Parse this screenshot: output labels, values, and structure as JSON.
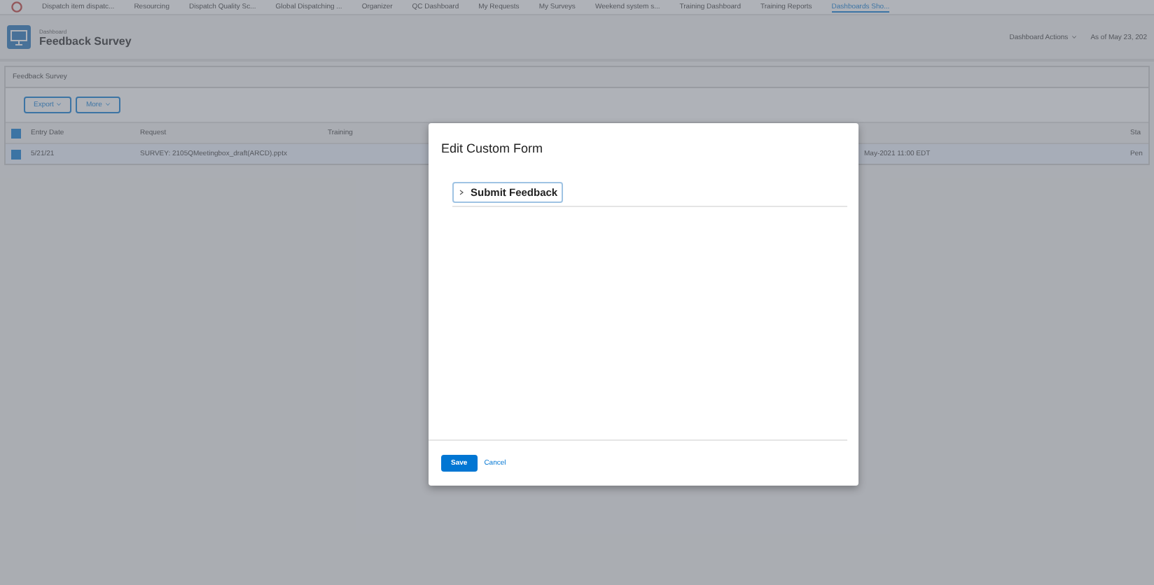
{
  "nav_tabs": [
    {
      "label": "Dispatch item dispatc...",
      "selected": false
    },
    {
      "label": "Resourcing",
      "selected": false
    },
    {
      "label": "Dispatch Quality Sc...",
      "selected": false
    },
    {
      "label": "Global Dispatching ...",
      "selected": false
    },
    {
      "label": "Organizer",
      "selected": false
    },
    {
      "label": "QC Dashboard",
      "selected": false
    },
    {
      "label": "My Requests",
      "selected": false
    },
    {
      "label": "My Surveys",
      "selected": false
    },
    {
      "label": "Weekend system s...",
      "selected": false
    },
    {
      "label": "Training Dashboard",
      "selected": false
    },
    {
      "label": "Training Reports",
      "selected": false
    },
    {
      "label": "Dashboards Sho...",
      "selected": true
    }
  ],
  "header": {
    "eyebrow": "Dashboard",
    "title": "Feedback Survey",
    "actions": "Dashboard Actions",
    "as_of": "As of May 23, 202"
  },
  "panel": {
    "title": "Feedback Survey",
    "buttons": [
      "Export",
      "More"
    ]
  },
  "table": {
    "select_all_checked": true,
    "columns": [
      "Entry Date",
      "Request",
      "Training",
      "",
      "Sta"
    ],
    "rows": [
      {
        "selected": true,
        "cells": [
          "5/21/21",
          "SURVEY: 2105QMeetingbox_draft(ARCD).pptx",
          "",
          "May-2021 11:00 EDT",
          "Pen"
        ]
      }
    ]
  },
  "modal": {
    "title": "Edit Custom Form",
    "sections": [
      {
        "label": "Submit Feedback",
        "expanded": false
      }
    ],
    "save": "Save",
    "cancel": "Cancel"
  }
}
